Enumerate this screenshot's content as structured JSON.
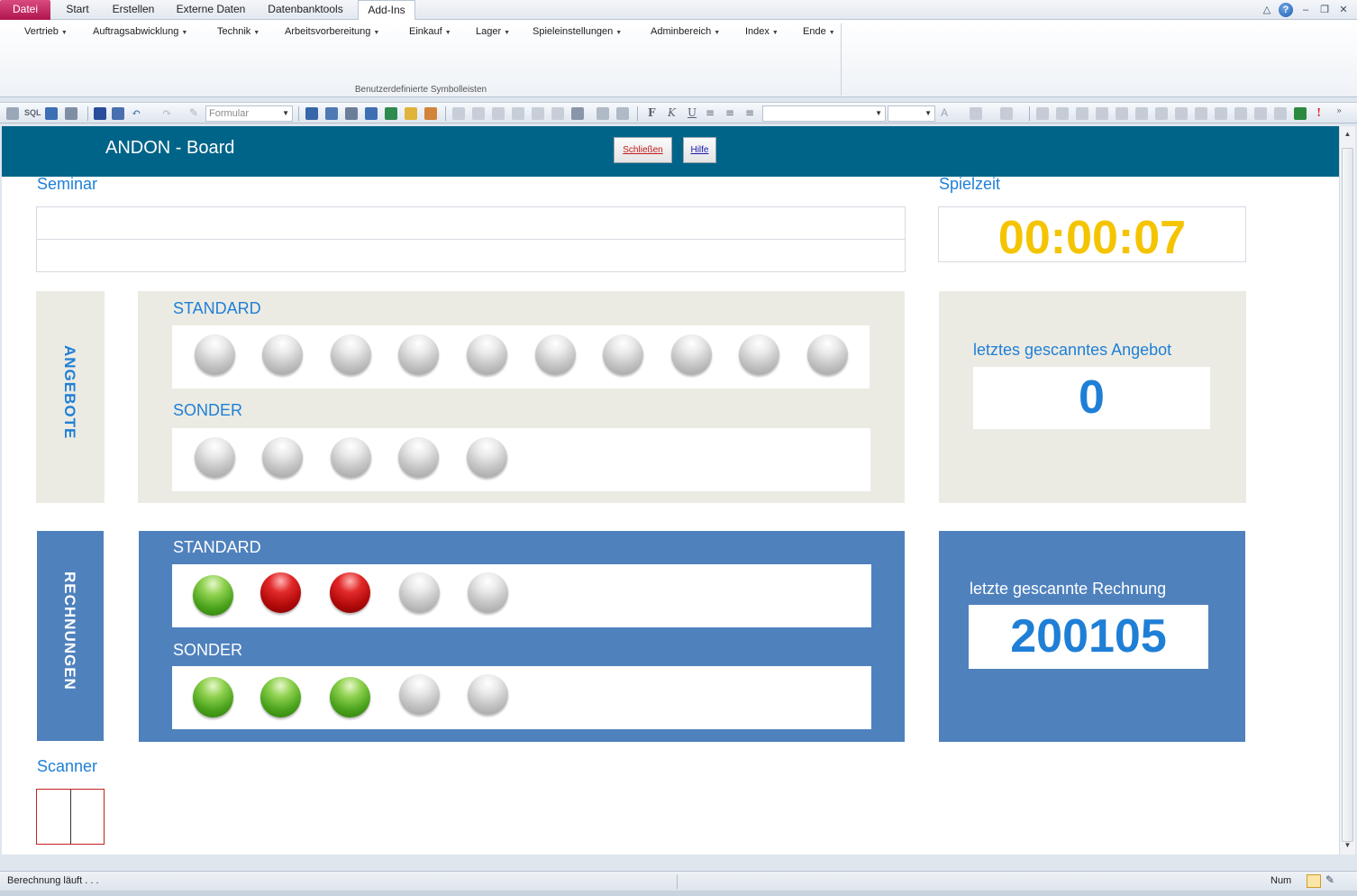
{
  "tabs": [
    "Datei",
    "Start",
    "Erstellen",
    "Externe Daten",
    "Datenbanktools",
    "Add-Ins"
  ],
  "window_controls": {
    "minimize_ribbon": "△",
    "help": "?",
    "minimize": "–",
    "restore": "❐",
    "close": "✕"
  },
  "menu": [
    "Vertrieb",
    "Auftragsabwicklung",
    "Technik",
    "Arbeitsvorbereitung",
    "Einkauf",
    "Lager",
    "Spieleinstellungen",
    "Adminbereich",
    "Index",
    "Ende"
  ],
  "ribbon_group_label": "Benutzerdefinierte Symbolleisten",
  "toolbar": {
    "sql_label": "SQL",
    "form_combo": "Formular",
    "bold": "F",
    "italic": "K",
    "underline": "U",
    "font_color": "A"
  },
  "form": {
    "title": "ANDON - Board",
    "close_button": "Schließen",
    "help_button": "Hilfe",
    "seminar_label": "Seminar",
    "playtime_label": "Spielzeit",
    "playtime_value": "00:00:07",
    "scanner_label": "Scanner"
  },
  "angebote": {
    "side_label": "ANGEBOTE",
    "standard_label": "STANDARD",
    "sonder_label": "SONDER",
    "standard_lights": [
      "grey",
      "grey",
      "grey",
      "grey",
      "grey",
      "grey",
      "grey",
      "grey",
      "grey",
      "grey"
    ],
    "sonder_lights": [
      "grey",
      "grey",
      "grey",
      "grey",
      "grey"
    ],
    "last_scanned_label": "letztes gescanntes Angebot",
    "last_scanned_value": "0"
  },
  "rechnungen": {
    "side_label": "RECHNUNGEN",
    "standard_label": "STANDARD",
    "sonder_label": "SONDER",
    "standard_lights": [
      "green",
      "red",
      "red",
      "grey",
      "grey"
    ],
    "sonder_lights": [
      "green",
      "green",
      "green",
      "grey",
      "grey"
    ],
    "last_scanned_label": "letzte gescannte Rechnung",
    "last_scanned_value": "200105"
  },
  "status": {
    "message": "Berechnung läuft . . .",
    "num": "Num"
  },
  "colors": {
    "header_bg": "#006489",
    "label_blue": "#1f7fd6",
    "timer_yellow": "#f5c400",
    "angebote_bg": "#ecebe3",
    "rechnungen_bg": "#4f81bd",
    "file_tab": "#c0185a"
  }
}
